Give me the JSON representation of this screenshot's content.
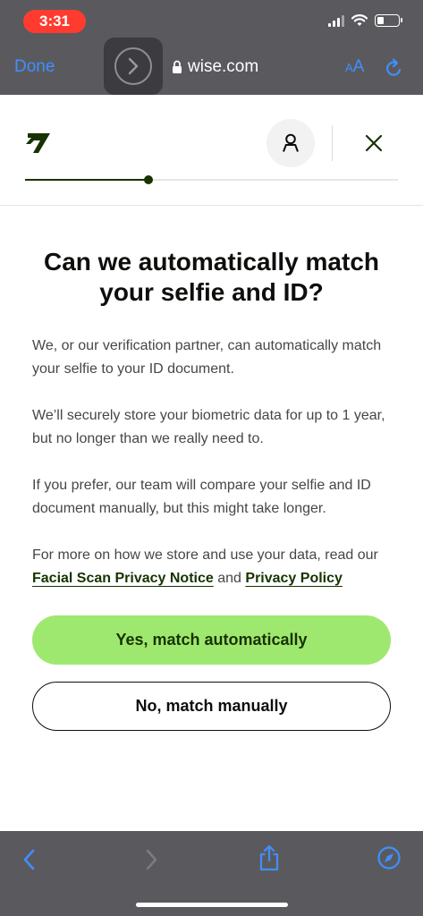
{
  "status_bar": {
    "time": "3:31"
  },
  "browser": {
    "done_label": "Done",
    "url": "wise.com",
    "aa_large": "A",
    "aa_small": "A"
  },
  "verification": {
    "progress": 0.33,
    "title": "Can we automatically match your selfie and ID?",
    "paragraphs": [
      "We, or our verification partner, can automatically match your selfie to your ID document.",
      "We’ll securely store your biometric data for up to 1 year, but no longer than we really need to.",
      "If you prefer, our team will compare your selfie and ID document manually, but this might take longer."
    ],
    "privacy_prefix": "For more on how we store and use your data, read our",
    "privacy_link_1": "Facial Scan Privacy Notice",
    "privacy_conj": "and",
    "privacy_link_2": "Privacy Policy",
    "primary_button": "Yes, match automatically",
    "secondary_button": "No, match manually"
  },
  "colors": {
    "brand_green": "#9fe870",
    "forest_green": "#163300",
    "ios_blue": "#3f8fff"
  },
  "icons": [
    "forward-icon",
    "lock-icon",
    "reload-icon",
    "wise-logo",
    "user-icon",
    "close-icon",
    "back-icon",
    "share-icon",
    "compass-icon"
  ]
}
